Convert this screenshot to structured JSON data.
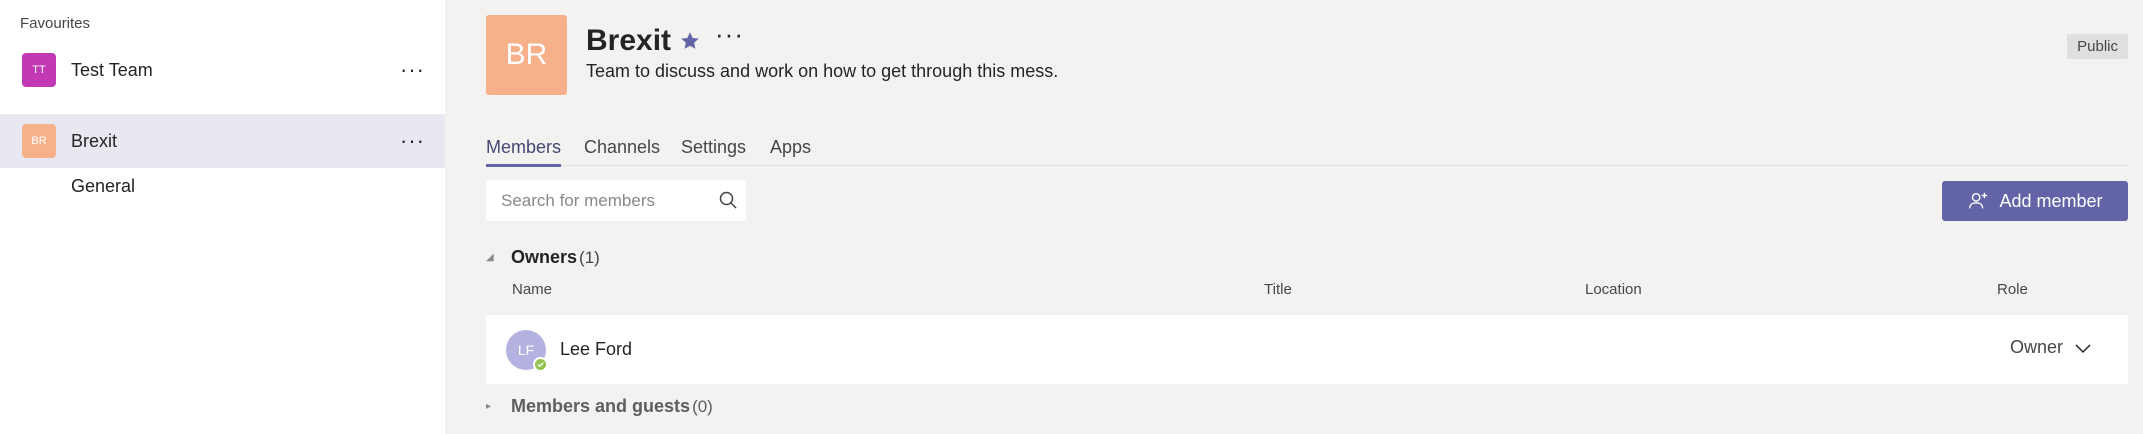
{
  "sidebar": {
    "favourites_heading": "Favourites",
    "teams": [
      {
        "initials": "TT",
        "name": "Test Team",
        "color": "#c239b3",
        "more": "···"
      },
      {
        "initials": "BR",
        "name": "Brexit",
        "color": "#f7b18a",
        "more": "···"
      }
    ],
    "channels": [
      {
        "name": "General"
      }
    ]
  },
  "header": {
    "initials": "BR",
    "title": "Brexit",
    "more": "···",
    "description": "Team to discuss and work on how to get through this mess.",
    "visibility": "Public"
  },
  "tabs": [
    {
      "label": "Members",
      "active": true
    },
    {
      "label": "Channels",
      "active": false
    },
    {
      "label": "Settings",
      "active": false
    },
    {
      "label": "Apps",
      "active": false
    }
  ],
  "search": {
    "placeholder": "Search for members",
    "value": ""
  },
  "add_member_label": "Add member",
  "owners": {
    "title": "Owners",
    "count": "(1)"
  },
  "columns": {
    "name": "Name",
    "title": "Title",
    "location": "Location",
    "role": "Role"
  },
  "members": [
    {
      "initials": "LF",
      "name": "Lee Ford",
      "role": "Owner",
      "presence": "available"
    }
  ],
  "guests": {
    "title": "Members and guests",
    "count": "(0)"
  },
  "colors": {
    "accent": "#6264a7",
    "presence_available": "#92c353"
  }
}
